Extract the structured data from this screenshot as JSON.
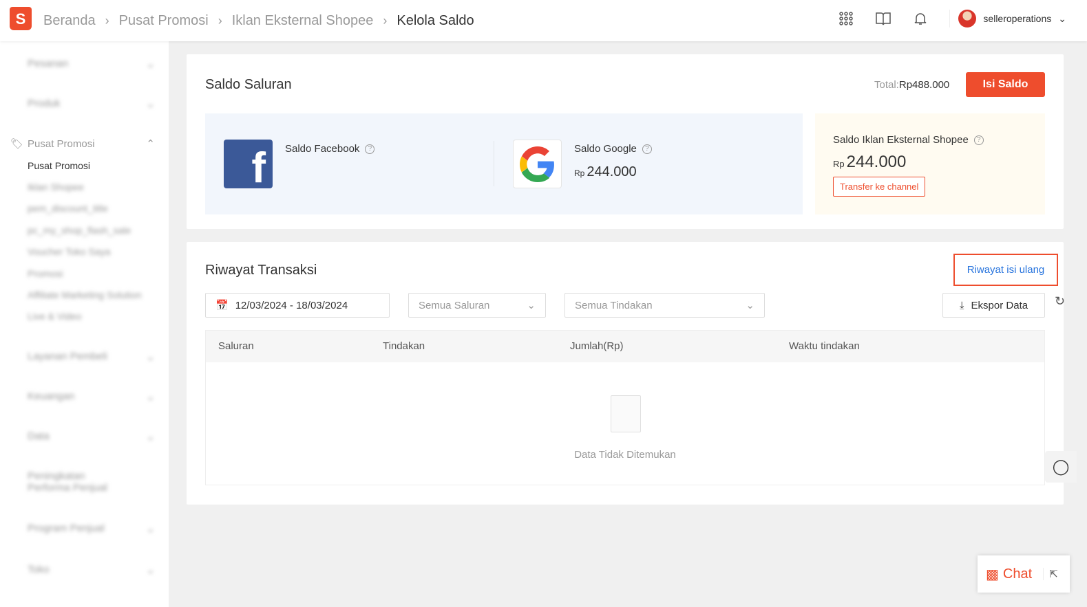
{
  "header": {
    "logo": "S",
    "breadcrumb": [
      "Beranda",
      "Pusat Promosi",
      "Iklan Eksternal Shopee",
      "Kelola Saldo"
    ],
    "username": "selleroperations",
    "icons": [
      "apps-grid-icon",
      "book-icon",
      "bell-icon"
    ]
  },
  "sidebar": {
    "groups": [
      {
        "label": "Pesanan"
      },
      {
        "label": "Produk"
      },
      {
        "label": "Pusat Promosi"
      },
      {
        "label": "Layanan Pembeli"
      },
      {
        "label": "Keuangan"
      },
      {
        "label": "Data"
      },
      {
        "label": "Peningkatan Performa Penjual"
      },
      {
        "label": "Program Penjual"
      },
      {
        "label": "Toko"
      }
    ],
    "promo_items": [
      "Pusat Promosi",
      "Iklan Shopee",
      "pem_discount_title",
      "pc_my_shop_flash_sale",
      "Voucher Toko Saya",
      "Promosi",
      "Affiliate Marketing Solution",
      "Live & Video"
    ]
  },
  "saldo": {
    "title": "Saldo Saluran",
    "total_label": "Total:",
    "total_value": "Rp488.000",
    "topup_button": "Isi Saldo",
    "facebook": {
      "label": "Saldo Facebook"
    },
    "google": {
      "label": "Saldo Google",
      "currency": "Rp",
      "value": "244.000"
    },
    "shopee": {
      "label": "Saldo Iklan Eksternal Shopee",
      "currency": "Rp",
      "value": "244.000",
      "transfer_button": "Transfer ke channel"
    }
  },
  "history": {
    "title": "Riwayat Transaksi",
    "topup_history_link": "Riwayat isi ulang",
    "date_range": "12/03/2024 - 18/03/2024",
    "channel_placeholder": "Semua Saluran",
    "action_placeholder": "Semua Tindakan",
    "export_button": "Ekspor Data",
    "columns": [
      "Saluran",
      "Tindakan",
      "Jumlah(Rp)",
      "Waktu tindakan"
    ],
    "empty_text": "Data Tidak Ditemukan"
  },
  "chat": {
    "label": "Chat"
  },
  "colors": {
    "accent": "#ee4d2d",
    "link": "#2673dd",
    "facebook": "#3b5998"
  }
}
